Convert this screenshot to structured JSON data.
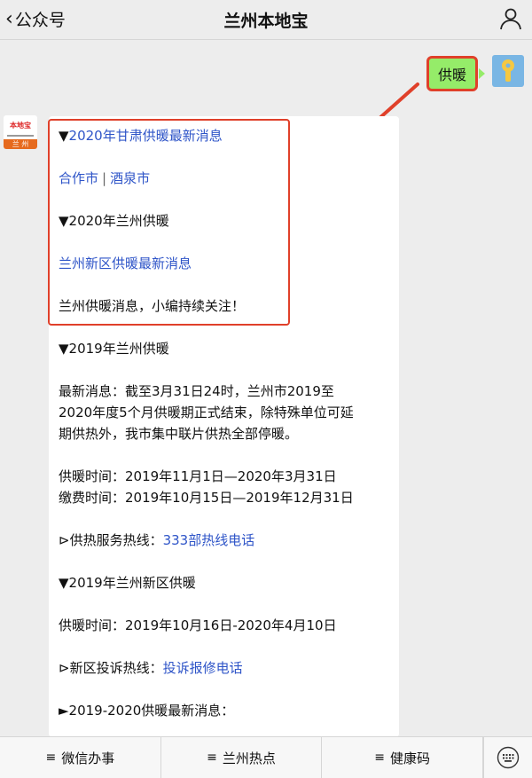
{
  "header": {
    "back_label": "公众号",
    "title": "兰州本地宝"
  },
  "user_message": "供暖",
  "bot_avatar": {
    "brand": "本地宝",
    "city": "兰 州"
  },
  "bot_lines": [
    {
      "text": "▼2020年甘肃供暖最新消息"
    },
    {
      "link1": "合作市",
      "link2": "酒泉市"
    },
    {
      "text": "▼2020年兰州供暖"
    },
    {
      "text": "兰州新区供暖最新消息"
    },
    {
      "text": "兰州供暖消息，小编持续关注！"
    },
    {
      "text": "▼2019年兰州供暖"
    },
    {
      "text": "最新消息：截至3月31日24时，兰州市2019至"
    },
    {
      "text": "2020年度5个月供暖期正式结束，除特殊单位可延"
    },
    {
      "text": "期供热外，我市集中联片供热全部停暖。"
    },
    {
      "text": "供暖时间：2019年11月1日—2020年3月31日"
    },
    {
      "text": "缴费时间：2019年10月15日—2019年12月31日"
    },
    {
      "prefix": "⊳供热服务热线：",
      "link": "333部热线电话"
    },
    {
      "text": "▼2019年兰州新区供暖"
    },
    {
      "text": "供暖时间：2019年10月16日-2020年4月10日"
    },
    {
      "prefix": "⊳新区投诉热线：",
      "link": "投诉报修电话"
    },
    {
      "text": "►2019-2020供暖最新消息："
    }
  ],
  "bottom_menu": {
    "items": [
      "微信办事",
      "兰州热点",
      "健康码"
    ],
    "menu_icon": "≡"
  },
  "colors": {
    "highlight_border": "#e0402a",
    "link": "#2f55c8",
    "my_bubble": "#95ec69"
  }
}
